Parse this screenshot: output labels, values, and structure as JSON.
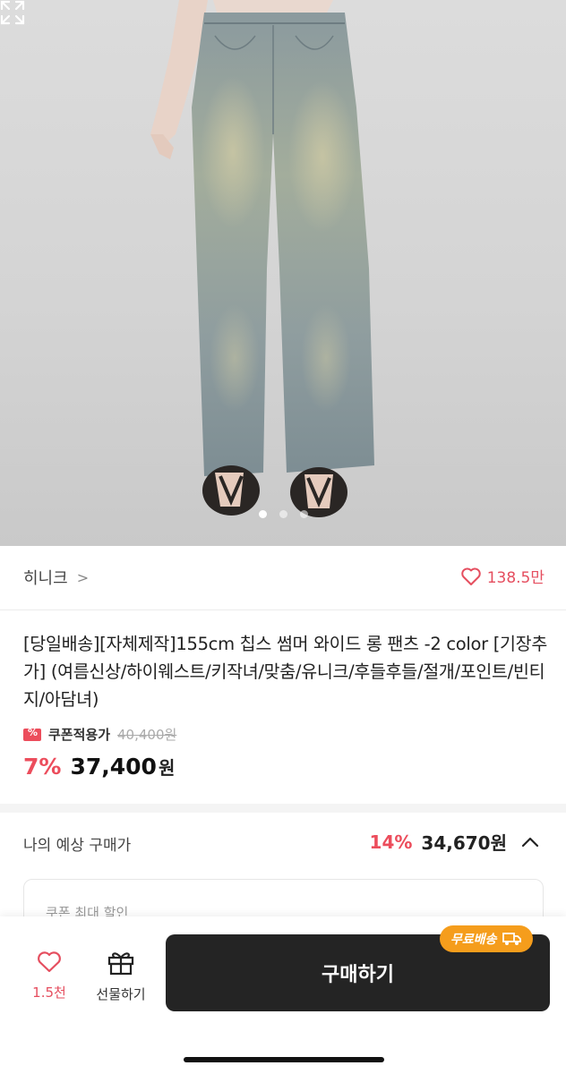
{
  "brand": {
    "name": "히니크",
    "chevron": ">"
  },
  "likes": {
    "count": "138.5만",
    "icon": "heart-outline-icon",
    "color": "#e54e5f"
  },
  "product": {
    "title": "[당일배송][자체제작]155cm 칩스 썸머 와이드 롱 팬츠 -2 color [기장추가] (여름신상/하이웨스트/키작녀/맞춤/유니크/후들후들/절개/포인트/빈티지/아담녀)",
    "coupon_label": "쿠폰적용가",
    "original_price": "40,400원",
    "discount_rate": "7%",
    "price": "37,400",
    "price_unit": "원"
  },
  "carousel": {
    "total": 3,
    "active_index": 0
  },
  "expected": {
    "label": "나의 예상 구매가",
    "discount_rate": "14%",
    "price": "34,670원"
  },
  "coupon_box": {
    "label": "쿠폰 최대 할인"
  },
  "bottom_bar": {
    "wish_count": "1.5천",
    "gift_label": "선물하기",
    "buy_label": "구매하기",
    "free_shipping_badge": "무료배송"
  },
  "colors": {
    "accent": "#ec4d5c",
    "buy_button": "#242424",
    "shipping_badge": "#f59d1c"
  }
}
